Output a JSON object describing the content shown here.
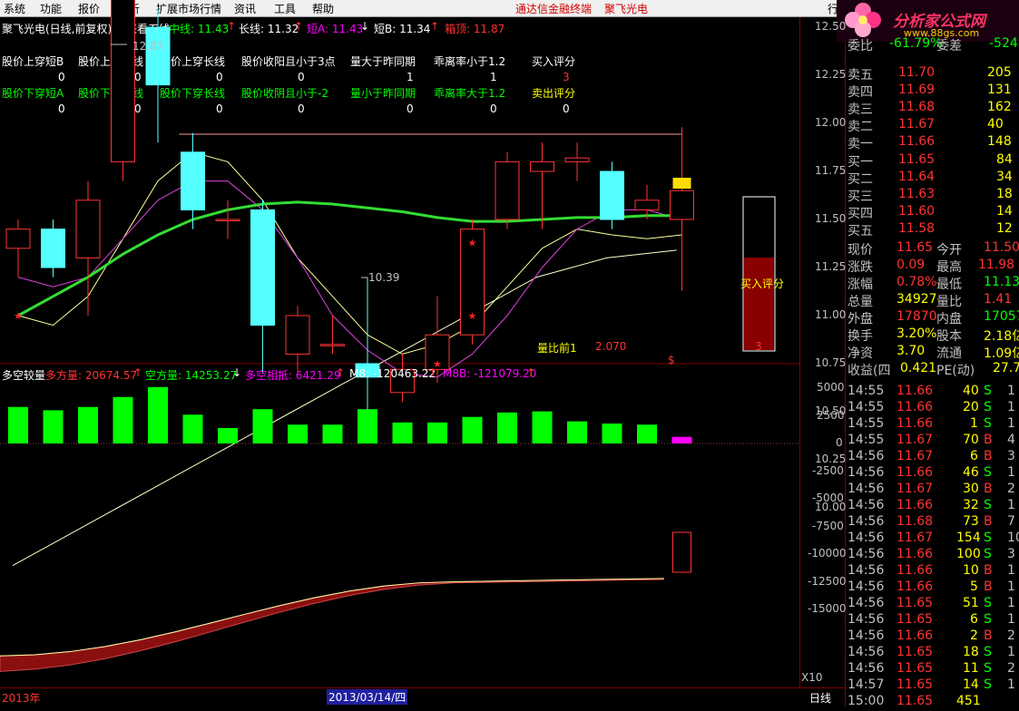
{
  "menu": [
    "系统",
    "功能",
    "报价",
    "分析",
    "扩展市场行情",
    "资讯",
    "工具",
    "帮助"
  ],
  "menu_red": [
    "通达信金融终端",
    "聚飞光电"
  ],
  "menu_right": "行",
  "logo": {
    "text": "分析家公式网",
    "url": "www.88gs.com"
  },
  "header": {
    "title": "聚飞光电(日线,前复权) 未来看五线",
    "mid_label": "中线: 11.43",
    "long_label": "长线: 11.32",
    "shortA_label": "短A: 11.43",
    "shortB_label": "短B: 11.34",
    "box_label": "箱顶: 11.87"
  },
  "signals_top": {
    "labels": [
      "股价上穿短B",
      "股价上穿中线",
      "股价上穿长线",
      "股价收阳且小于3点",
      "量大于昨同期",
      "乖离率小于1.2",
      "买入评分"
    ],
    "values": [
      "0",
      "0",
      "0",
      "0",
      "1",
      "1",
      "3"
    ]
  },
  "signals_bottom": {
    "labels": [
      "股价下穿短A",
      "股价下穿中线",
      "股价下穿长线",
      "股价收阴且小于-2",
      "量小于昨同期",
      "乖离率大于1.2",
      "卖出评分"
    ],
    "values": [
      "0",
      "0",
      "0",
      "0",
      "0",
      "0",
      "0"
    ]
  },
  "price_axis": [
    "12.50",
    "12.25",
    "12.00",
    "11.75",
    "11.50",
    "11.25",
    "11.00",
    "10.75",
    "10.50",
    "10.25",
    "10.00"
  ],
  "high_marker": "12.87",
  "low_marker": "10.39",
  "buy_score_label": "买入评分",
  "buy_score_value": "3",
  "vol_ratio": {
    "label": "量比前1",
    "value": "2.070"
  },
  "dollar_sign": "$",
  "indicator_header": {
    "name": "多空较量",
    "long_label": "多方量: 20674.57",
    "short_label": "空方量: 14253.27",
    "diff_label": "多空相抵: 6421.29",
    "m8_label": "M8: -120463.22",
    "m8b_label": "M8B: -121079.20"
  },
  "ind_axis": [
    "5000",
    "2500",
    "0",
    "-2500",
    "-5000",
    "-7500",
    "-10000",
    "-12500",
    "-15000"
  ],
  "x10": "X10",
  "bottom": {
    "year": "2013年",
    "date": "2013/03/14/四",
    "period": "日线"
  },
  "quote": {
    "top_partial": [
      "委比",
      "-61.79%",
      "委差",
      "-524"
    ],
    "asks": [
      [
        "卖五",
        "11.70",
        "205"
      ],
      [
        "卖四",
        "11.69",
        "131"
      ],
      [
        "卖三",
        "11.68",
        "162"
      ],
      [
        "卖二",
        "11.67",
        "40"
      ],
      [
        "卖一",
        "11.66",
        "148"
      ]
    ],
    "bids": [
      [
        "买一",
        "11.65",
        "84"
      ],
      [
        "买二",
        "11.64",
        "34"
      ],
      [
        "买三",
        "11.63",
        "18"
      ],
      [
        "买四",
        "11.60",
        "14"
      ],
      [
        "买五",
        "11.58",
        "12"
      ]
    ],
    "stats": [
      [
        "现价",
        "11.65",
        "今开",
        "11.50"
      ],
      [
        "涨跌",
        "0.09",
        "最高",
        "11.98"
      ],
      [
        "涨幅",
        "0.78%",
        "最低",
        "11.13"
      ],
      [
        "总量",
        "34927",
        "量比",
        "1.41"
      ],
      [
        "外盘",
        "17870",
        "内盘",
        "17057"
      ],
      [
        "换手",
        "3.20%",
        "股本",
        "2.18亿"
      ],
      [
        "净资",
        "3.70",
        "流通",
        "1.09亿"
      ],
      [
        "收益(四",
        "0.421",
        "PE(动)",
        "27.7"
      ]
    ]
  },
  "ticks": [
    [
      "14:55",
      "11.66",
      "40",
      "S",
      "1"
    ],
    [
      "14:55",
      "11.66",
      "20",
      "S",
      "1"
    ],
    [
      "14:55",
      "11.66",
      "1",
      "S",
      "1"
    ],
    [
      "14:55",
      "11.67",
      "70",
      "B",
      "4"
    ],
    [
      "14:56",
      "11.67",
      "6",
      "B",
      "3"
    ],
    [
      "14:56",
      "11.66",
      "46",
      "S",
      "1"
    ],
    [
      "14:56",
      "11.67",
      "30",
      "B",
      "2"
    ],
    [
      "14:56",
      "11.66",
      "32",
      "S",
      "1"
    ],
    [
      "14:56",
      "11.68",
      "73",
      "B",
      "7"
    ],
    [
      "14:56",
      "11.67",
      "154",
      "S",
      "10"
    ],
    [
      "14:56",
      "11.66",
      "100",
      "S",
      "3"
    ],
    [
      "14:56",
      "11.66",
      "10",
      "B",
      "1"
    ],
    [
      "14:56",
      "11.66",
      "5",
      "B",
      "1"
    ],
    [
      "14:56",
      "11.65",
      "51",
      "S",
      "1"
    ],
    [
      "14:56",
      "11.65",
      "6",
      "S",
      "1"
    ],
    [
      "14:56",
      "11.66",
      "2",
      "B",
      "2"
    ],
    [
      "14:56",
      "11.65",
      "18",
      "S",
      "1"
    ],
    [
      "14:56",
      "11.65",
      "11",
      "S",
      "2"
    ],
    [
      "14:57",
      "11.65",
      "14",
      "S",
      "1"
    ],
    [
      "15:00",
      "11.65",
      "451",
      "",
      ""
    ]
  ],
  "chart_data": {
    "type": "candlestick",
    "candles": [
      {
        "o": 11.35,
        "c": 11.45,
        "h": 11.5,
        "l": 11.2,
        "color": "red"
      },
      {
        "o": 11.45,
        "c": 11.25,
        "h": 11.5,
        "l": 11.2,
        "color": "cyan"
      },
      {
        "o": 11.3,
        "c": 11.6,
        "h": 11.7,
        "l": 11.0,
        "color": "red"
      },
      {
        "o": 11.8,
        "c": 12.8,
        "h": 12.87,
        "l": 11.7,
        "color": "red"
      },
      {
        "o": 12.5,
        "c": 12.2,
        "h": 12.6,
        "l": 11.9,
        "color": "cyan"
      },
      {
        "o": 11.85,
        "c": 11.55,
        "h": 11.95,
        "l": 11.45,
        "color": "cyan"
      },
      {
        "o": 11.5,
        "c": 11.5,
        "h": 11.6,
        "l": 11.4,
        "color": "red"
      },
      {
        "o": 11.55,
        "c": 10.95,
        "h": 11.6,
        "l": 10.7,
        "color": "cyan"
      },
      {
        "o": 10.8,
        "c": 11.0,
        "h": 11.05,
        "l": 10.7,
        "color": "red"
      },
      {
        "o": 10.85,
        "c": 10.85,
        "h": 11.0,
        "l": 10.8,
        "color": "red"
      },
      {
        "o": 10.75,
        "c": 10.68,
        "h": 11.2,
        "l": 10.39,
        "color": "cyan"
      },
      {
        "o": 10.6,
        "c": 10.72,
        "h": 10.8,
        "l": 10.55,
        "color": "red"
      },
      {
        "o": 10.72,
        "c": 10.9,
        "h": 11.1,
        "l": 10.65,
        "color": "red"
      },
      {
        "o": 10.9,
        "c": 11.45,
        "h": 11.5,
        "l": 10.85,
        "color": "red"
      },
      {
        "o": 11.5,
        "c": 11.8,
        "h": 11.85,
        "l": 11.45,
        "color": "red"
      },
      {
        "o": 11.75,
        "c": 11.8,
        "h": 11.9,
        "l": 11.45,
        "color": "red"
      },
      {
        "o": 11.82,
        "c": 11.8,
        "h": 11.9,
        "l": 11.7,
        "color": "red"
      },
      {
        "o": 11.75,
        "c": 11.5,
        "h": 11.8,
        "l": 11.45,
        "color": "cyan"
      },
      {
        "o": 11.55,
        "c": 11.6,
        "h": 11.68,
        "l": 11.5,
        "color": "red"
      },
      {
        "o": 11.5,
        "c": 11.65,
        "h": 11.98,
        "l": 11.13,
        "color": "red"
      }
    ],
    "green_ma": [
      11.0,
      11.1,
      11.2,
      11.32,
      11.42,
      11.5,
      11.55,
      11.58,
      11.59,
      11.58,
      11.56,
      11.54,
      11.51,
      11.49,
      11.49,
      11.5,
      11.51,
      11.51,
      11.52,
      11.52
    ],
    "magenta_ma": [
      11.2,
      11.15,
      11.2,
      11.4,
      11.6,
      11.7,
      11.7,
      11.55,
      11.3,
      11.0,
      10.82,
      10.7,
      10.68,
      10.8,
      11.0,
      11.25,
      11.45,
      11.55,
      11.55,
      11.5
    ],
    "yellow_ma": [
      11.0,
      10.95,
      11.1,
      11.4,
      11.7,
      11.85,
      11.8,
      11.6,
      11.3,
      11.1,
      10.9,
      10.8,
      10.85,
      10.95,
      11.15,
      11.35,
      11.45,
      11.42,
      11.4,
      11.42
    ],
    "long_line": [
      9.7,
      9.8,
      9.9,
      10.0,
      10.1,
      10.2,
      10.3,
      10.4,
      10.5,
      10.6,
      10.7,
      10.8,
      10.9,
      11.0,
      11.1,
      11.2,
      11.25,
      11.3,
      11.32,
      11.34
    ],
    "volume": [
      3300,
      3000,
      3300,
      4200,
      5100,
      2600,
      1400,
      3100,
      1700,
      1700,
      3100,
      1900,
      1900,
      2400,
      2800,
      2900,
      2000,
      1800,
      1700,
      600
    ]
  }
}
